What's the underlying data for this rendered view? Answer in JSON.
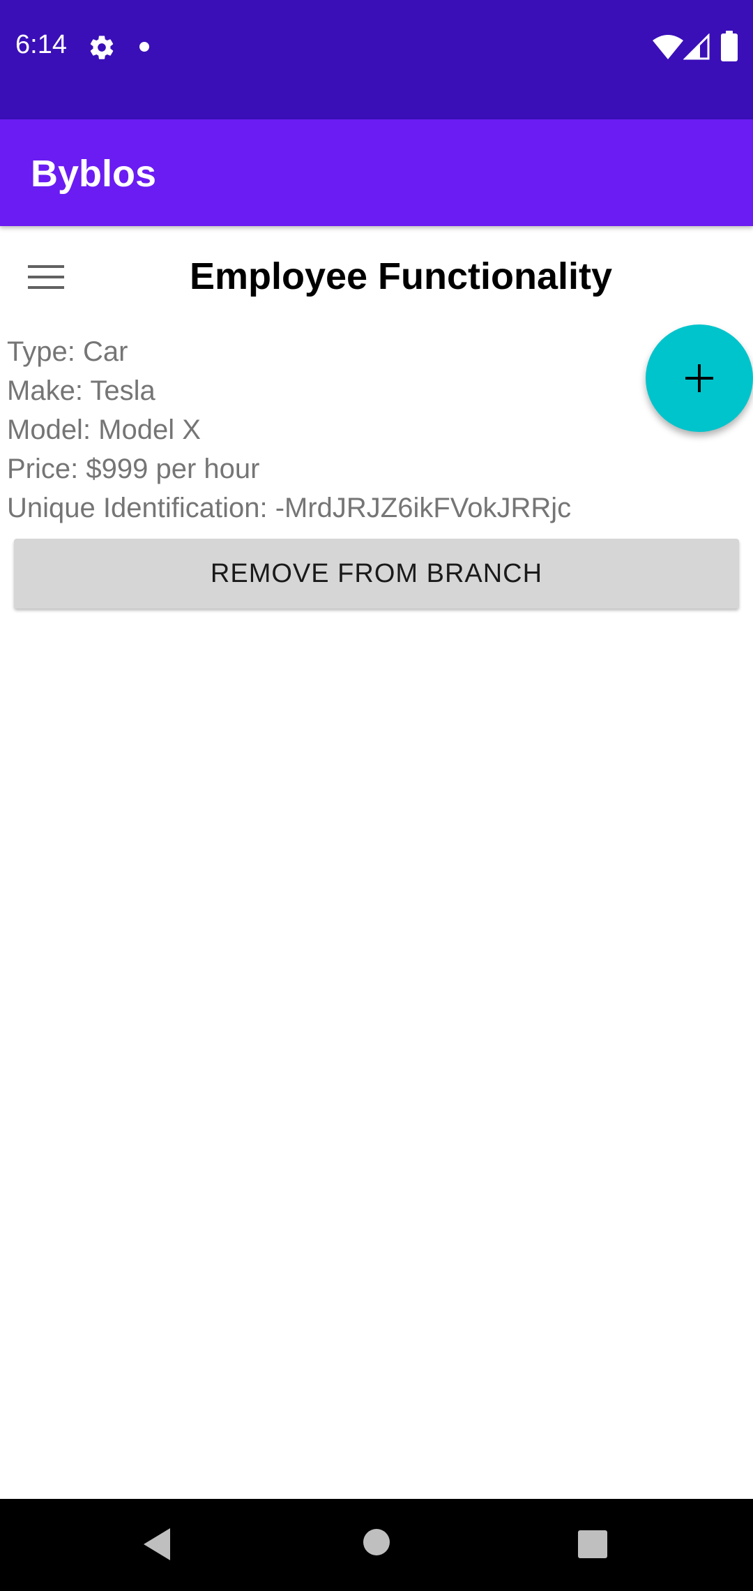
{
  "status_bar": {
    "time": "6:14",
    "icons": [
      "gear-icon",
      "notification-dot-icon",
      "wifi-icon",
      "signal-icon",
      "battery-icon"
    ]
  },
  "app_bar": {
    "title": "Byblos"
  },
  "page": {
    "heading": "Employee Functionality",
    "menu_icon": "hamburger-menu-icon"
  },
  "item": {
    "type": "Type: Car",
    "make": "Make: Tesla",
    "model": "Model: Model X",
    "price": "Price: $999 per hour",
    "unique_id": "Unique Identification: -MrdJRJZ6ikFVokJRRjc"
  },
  "actions": {
    "remove_label": "REMOVE FROM BRANCH",
    "fab_icon": "plus-icon"
  },
  "nav_bar": {
    "icons": [
      "back-icon",
      "home-icon",
      "recents-icon"
    ]
  },
  "colors": {
    "status_bar": "#3a0fb8",
    "app_bar": "#6a1cf2",
    "fab": "#00c4cc",
    "button": "#d6d6d6",
    "secondary_text": "#757575"
  }
}
